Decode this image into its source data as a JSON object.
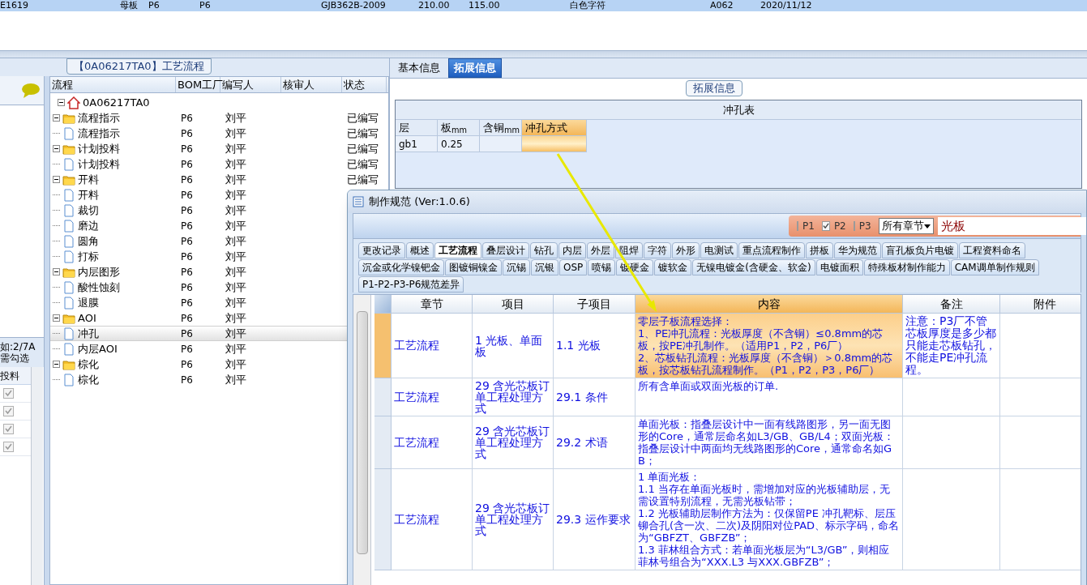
{
  "top_row": {
    "cells": [
      "E1619",
      "母板",
      "P6",
      "P6",
      "GJB362B-2009",
      "210.00",
      "115.00",
      "白色字符",
      "A062",
      "2020/11/12"
    ]
  },
  "left_panel": {
    "note_lines": [
      "如:2/7A",
      "需勾选"
    ],
    "column_header": "投料",
    "checkboxes": [
      {
        "checked": true
      },
      {
        "checked": true
      },
      {
        "checked": true
      },
      {
        "checked": true
      }
    ]
  },
  "flow_panel": {
    "title": "【0A06217TA0】工艺流程",
    "columns": [
      "流程",
      "BOM工厂",
      "编写人",
      "核审人",
      "状态"
    ],
    "tree": [
      {
        "label": "0A06217TA0",
        "kind": "root",
        "expanded": true,
        "selected": false,
        "children": [
          {
            "label": "流程指示",
            "kind": "folder",
            "expanded": true,
            "selected": false,
            "bom": "P6",
            "author": "刘平",
            "status": "已编写",
            "children": [
              {
                "label": "流程指示",
                "kind": "page",
                "selected": false,
                "bom": "P6",
                "author": "刘平",
                "status": "已编写"
              }
            ]
          },
          {
            "label": "计划投料",
            "kind": "folder",
            "expanded": true,
            "selected": false,
            "bom": "P6",
            "author": "刘平",
            "status": "已编写",
            "children": [
              {
                "label": "计划投料",
                "kind": "page",
                "selected": false,
                "bom": "P6",
                "author": "刘平",
                "status": "已编写"
              }
            ]
          },
          {
            "label": "开料",
            "kind": "folder",
            "expanded": true,
            "selected": false,
            "bom": "P6",
            "author": "刘平",
            "status": "已编写",
            "children": [
              {
                "label": "开料",
                "kind": "page",
                "selected": false,
                "bom": "P6",
                "author": "刘平"
              },
              {
                "label": "裁切",
                "kind": "page",
                "selected": false,
                "bom": "P6",
                "author": "刘平"
              },
              {
                "label": "磨边",
                "kind": "page",
                "selected": false,
                "bom": "P6",
                "author": "刘平"
              },
              {
                "label": "圆角",
                "kind": "page",
                "selected": false,
                "bom": "P6",
                "author": "刘平"
              },
              {
                "label": "打标",
                "kind": "page",
                "selected": false,
                "bom": "P6",
                "author": "刘平"
              }
            ]
          },
          {
            "label": "内层图形",
            "kind": "folder",
            "expanded": true,
            "selected": false,
            "bom": "P6",
            "author": "刘平",
            "children": [
              {
                "label": "酸性蚀刻",
                "kind": "page",
                "selected": false,
                "bom": "P6",
                "author": "刘平"
              },
              {
                "label": "退膜",
                "kind": "page",
                "selected": false,
                "bom": "P6",
                "author": "刘平"
              }
            ]
          },
          {
            "label": "AOI",
            "kind": "folder",
            "expanded": true,
            "selected": false,
            "bom": "P6",
            "author": "刘平",
            "children": [
              {
                "label": "冲孔",
                "kind": "page",
                "selected": true,
                "bom": "P6",
                "author": "刘平"
              },
              {
                "label": "内层AOI",
                "kind": "page",
                "selected": false,
                "bom": "P6",
                "author": "刘平"
              }
            ]
          },
          {
            "label": "棕化",
            "kind": "folder",
            "expanded": true,
            "selected": false,
            "bom": "P6",
            "author": "刘平",
            "children": [
              {
                "label": "棕化",
                "kind": "page",
                "selected": false,
                "bom": "P6",
                "author": "刘平"
              }
            ]
          }
        ]
      }
    ]
  },
  "info_panel": {
    "tabs": [
      {
        "label": "基本信息",
        "selected": false
      },
      {
        "label": "拓展信息",
        "selected": true
      }
    ],
    "group_title": "拓展信息",
    "table_title": "冲孔表",
    "columns": [
      {
        "label": "层",
        "selected": false
      },
      {
        "label": "板$_{mm}$",
        "selected": false
      },
      {
        "label": "含铜$_{mm}$",
        "selected": false
      },
      {
        "label": "冲孔方式",
        "selected": true
      }
    ],
    "rows": [
      [
        "gb1",
        "0.25",
        "",
        ""
      ]
    ]
  },
  "spec_window": {
    "title": "制作规范 (Ver:1.0.6)",
    "filters": [
      {
        "label": "P1",
        "checked": false
      },
      {
        "label": "P2",
        "checked": true
      },
      {
        "label": "P3",
        "checked": false
      }
    ],
    "chapter_select": "所有章节",
    "search_value": "光板",
    "tab_rows": [
      [
        {
          "label": "更改记录",
          "selected": false
        },
        {
          "label": "概述",
          "selected": false
        },
        {
          "label": "工艺流程",
          "selected": true
        },
        {
          "label": "叠层设计",
          "selected": false
        },
        {
          "label": "钻孔",
          "selected": false
        },
        {
          "label": "内层",
          "selected": false
        },
        {
          "label": "外层",
          "selected": false
        },
        {
          "label": "阻焊",
          "selected": false
        },
        {
          "label": "字符",
          "selected": false
        },
        {
          "label": "外形",
          "selected": false
        },
        {
          "label": "电测试",
          "selected": false
        },
        {
          "label": "重点流程制作",
          "selected": false
        },
        {
          "label": "拼板",
          "selected": false
        },
        {
          "label": "华为规范",
          "selected": false
        },
        {
          "label": "盲孔板负片电镀",
          "selected": false
        },
        {
          "label": "工程资料命名",
          "selected": false
        }
      ],
      [
        {
          "label": "沉金或化学镍钯金",
          "selected": false
        },
        {
          "label": "图镀铜镍金",
          "selected": false
        },
        {
          "label": "沉锡",
          "selected": false
        },
        {
          "label": "沉银",
          "selected": false
        },
        {
          "label": "OSP",
          "selected": false
        },
        {
          "label": "喷锡",
          "selected": false
        },
        {
          "label": "镀硬金",
          "selected": false
        },
        {
          "label": "镀软金",
          "selected": false
        },
        {
          "label": "无镍电镀金(含硬金、软金)",
          "selected": false
        },
        {
          "label": "电镀面积",
          "selected": false
        },
        {
          "label": "特殊板材制作能力",
          "selected": false
        },
        {
          "label": "CAM调单制作规则",
          "selected": false
        }
      ],
      [
        {
          "label": "P1-P2-P3-P6规范差异",
          "selected": false
        }
      ]
    ],
    "columns": [
      "章节",
      "项目",
      "子项目",
      "内容",
      "备注",
      "附件"
    ],
    "rows": [
      {
        "chapter": "工艺流程",
        "item": "1 光板、单面板",
        "sub_item": "1.1 光板",
        "content": "零层子板流程选择：\n1、PE冲孔流程：光板厚度（不含铜）≤0.8mm的芯板，按PE冲孔制作。（适用P1，P2，P6厂）\n2、芯板钻孔流程：光板厚度（不含铜）＞0.8mm的芯板，按芯板钻孔流程制作。（P1，P2，P3，P6厂）",
        "note": "注意：P3厂不管芯板厚度是多少都只能走芯板钻孔，不能走PE冲孔流程。",
        "selected": true
      },
      {
        "chapter": "工艺流程",
        "item": "29 含光芯板订单工程处理方式",
        "sub_item": "29.1 条件",
        "content": "所有含单面或双面光板的订单.",
        "selected": false
      },
      {
        "chapter": "工艺流程",
        "item": "29 含光芯板订单工程处理方式",
        "sub_item": "29.2 术语",
        "content": "单面光板：指叠层设计中一面有线路图形，另一面无图形的Core，通常层命名如L3/GB、GB/L4；双面光板：指叠层设计中两面均无线路图形的Core，通常命名如GB；",
        "selected": false
      },
      {
        "chapter": "工艺流程",
        "item": "29 含光芯板订单工程处理方式",
        "sub_item": "29.3 运作要求",
        "content": "1 单面光板：\n1.1 当存在单面光板时，需增加对应的光板辅助层，无需设置特别流程，无需光板钻带；\n1.2 光板辅助层制作方法为：仅保留PE 冲孔靶标、层压铆合孔(含一次、二次)及阴阳对位PAD、标示字码，命名为“GBFZT、GBFZB”；\n1.3 菲林组合方式：若单面光板层为“L3/GB”，则相应菲林号组合为“XXX.L3 与XXX.GBFZB”；",
        "selected": false
      }
    ]
  }
}
